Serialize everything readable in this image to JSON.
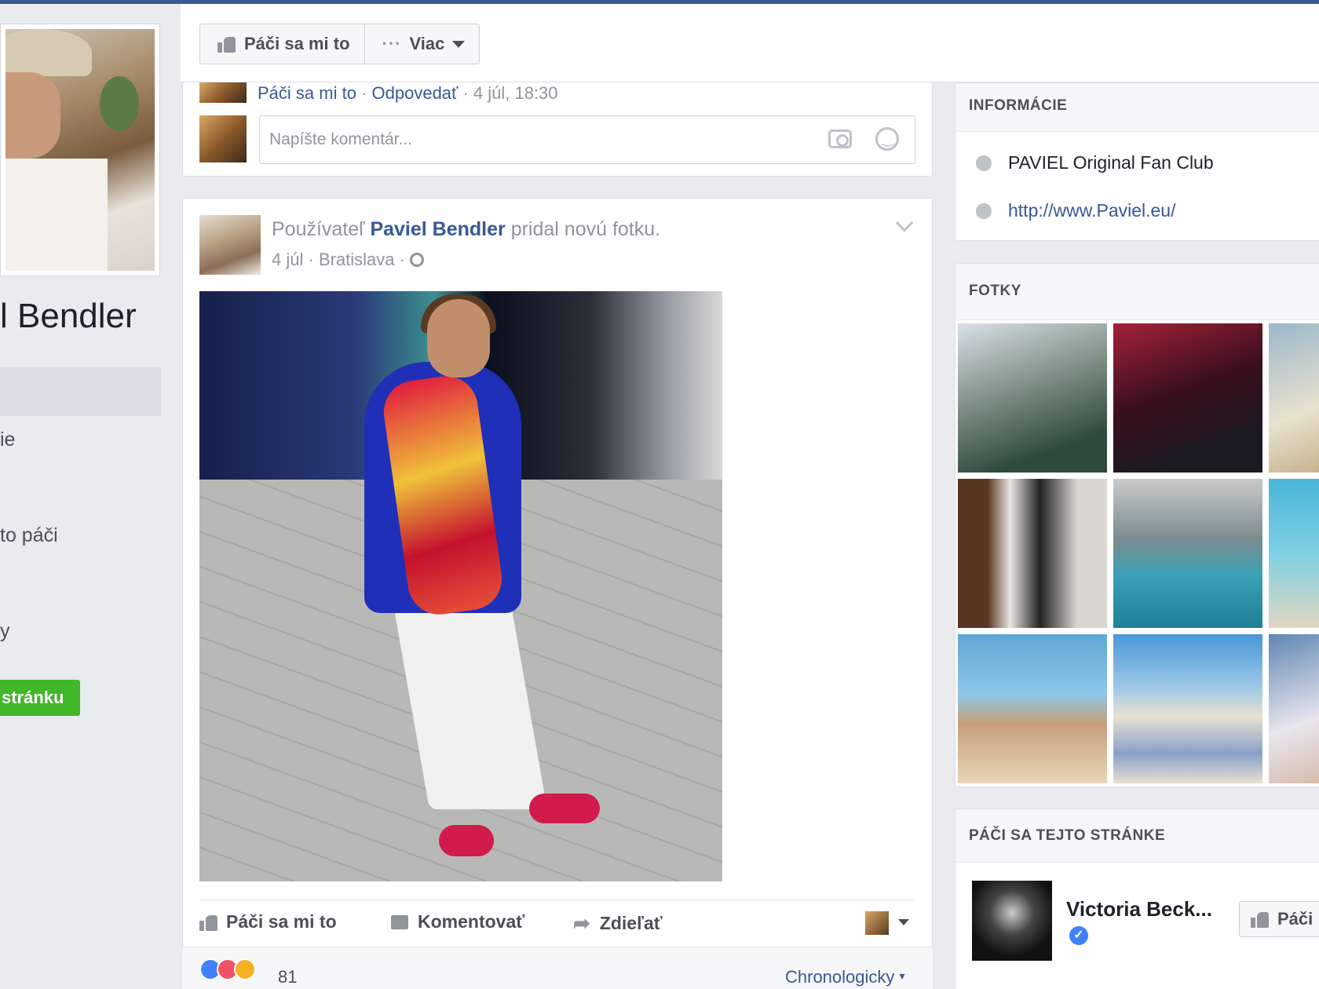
{
  "page": {
    "name_partial": "l Bendler"
  },
  "left_nav": {
    "items": [
      {
        "label": "ie"
      },
      {
        "label": "to páči"
      },
      {
        "label": "y"
      }
    ],
    "like_page_button": "stránku"
  },
  "top_bar": {
    "like_button": "Páči sa mi to",
    "more_button": "Viac"
  },
  "prev_post": {
    "comment_like": "Páči sa mi to",
    "comment_reply": "Odpovedať",
    "comment_time": "4 júl, 18:30",
    "comment_placeholder": "Napíšte komentár..."
  },
  "post": {
    "prefix": "Používateľ",
    "author": "Paviel Bendler",
    "suffix": "pridal novú fotku.",
    "date": "4 júl",
    "location": "Bratislava",
    "actions": {
      "like": "Páči sa mi to",
      "comment": "Komentovať",
      "share": "Zdieľať"
    },
    "reaction_count": "81",
    "sort_label": "Chronologicky"
  },
  "sidebar": {
    "info": {
      "title": "INFORMÁCIE",
      "about": "PAVIEL Original Fan Club",
      "website": "http://www.Paviel.eu/"
    },
    "photos": {
      "title": "FOTKY"
    },
    "liked_pages": {
      "title": "PÁČI SA TEJTO STRÁNKE",
      "items": [
        {
          "name": "Victoria Beck...",
          "button": "Páči"
        }
      ]
    }
  },
  "colors": {
    "brand": "#3b5998",
    "link": "#385898",
    "like_green": "#42b72a",
    "background": "#e9ebee"
  }
}
